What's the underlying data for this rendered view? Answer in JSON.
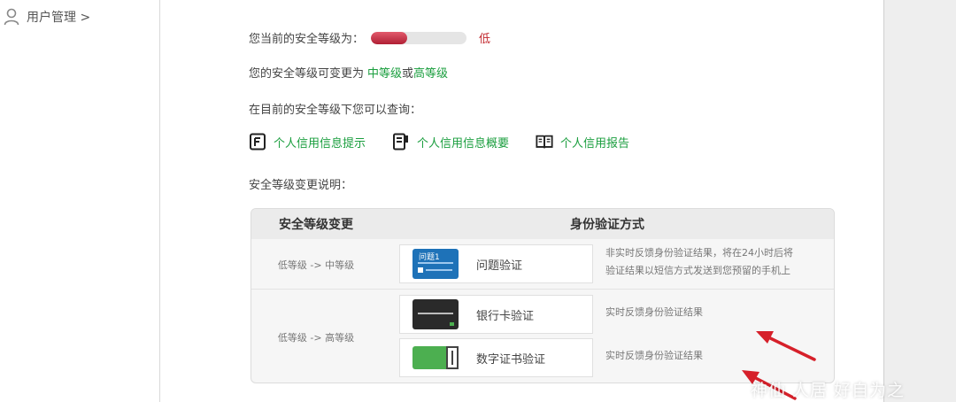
{
  "sidebar": {
    "user_mgmt_label": "用户管理 >"
  },
  "security": {
    "current_level_label": "您当前的安全等级为：",
    "level_value": "低",
    "level_fraction": 0.38,
    "changeable_prefix": "您的安全等级可变更为",
    "middle_level_link": "中等级",
    "or_text": "或",
    "high_level_link": "高等级",
    "query_intro": "在目前的安全等级下您可以查询："
  },
  "query_links": [
    {
      "icon": "document-icon",
      "label": "个人信用信息提示"
    },
    {
      "icon": "document-summary-icon",
      "label": "个人信用信息概要"
    },
    {
      "icon": "book-icon",
      "label": "个人信用报告"
    }
  ],
  "change_notes_label": "安全等级变更说明：",
  "table": {
    "header_change": "安全等级变更",
    "header_method": "身份验证方式",
    "rows": [
      {
        "level_change": "低等级 -> 中等级",
        "methods": [
          {
            "icon": "question-card-icon",
            "icon_text": "问题1",
            "label": "问题验证"
          }
        ],
        "desc_line1": "非实时反馈身份验证结果，将在24小时后将",
        "desc_line2": "验证结果以短信方式发送到您预留的手机上"
      },
      {
        "level_change": "低等级 -> 高等级",
        "methods": [
          {
            "icon": "bank-card-icon",
            "label": "银行卡验证",
            "desc": "实时反馈身份验证结果"
          },
          {
            "icon": "digital-certificate-icon",
            "label": "数字证书验证",
            "desc": "实时反馈身份验证结果"
          }
        ]
      }
    ]
  },
  "watermark": "神仙  人居   好自为之",
  "colors": {
    "accent_green": "#1a9e3e",
    "level_low_red": "#c2272d",
    "arrow_red": "#d6202a"
  }
}
